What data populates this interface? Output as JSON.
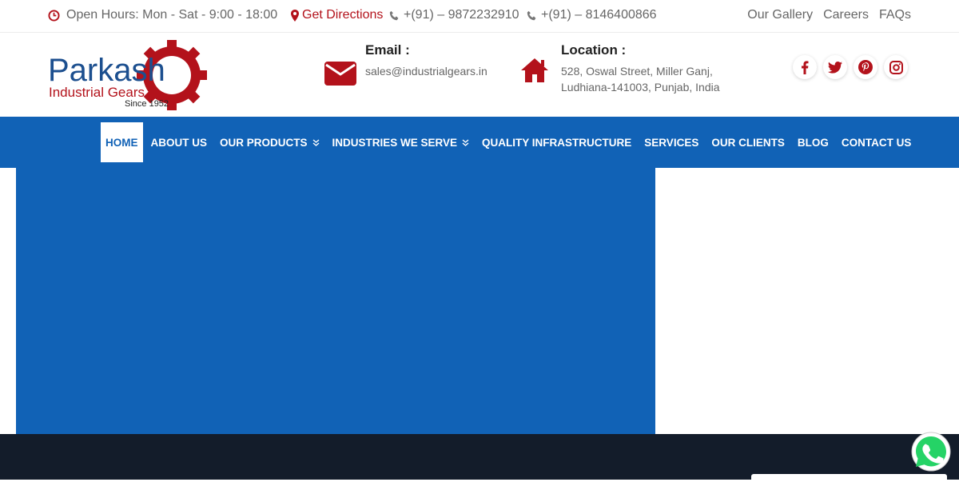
{
  "topbar": {
    "hours": "Open Hours: Mon - Sat - 9:00 - 18:00",
    "directions": "Get Directions",
    "phone1": "+(91) – 9872232910",
    "phone2": "+(91) – 8146400866",
    "links": [
      "Our Gallery",
      "Careers",
      "FAQs"
    ]
  },
  "header": {
    "logo": {
      "name": "Parkash",
      "sub": "Industrial Gears",
      "since": "Since 1952"
    },
    "email": {
      "title": "Email :",
      "value": "sales@industrialgears.in"
    },
    "location": {
      "title": "Location :",
      "line1": "528, Oswal Street, Miller Ganj,",
      "line2": "Ludhiana-141003, Punjab, India"
    },
    "social": [
      "facebook-icon",
      "twitter-icon",
      "pinterest-icon",
      "instagram-icon"
    ]
  },
  "nav": {
    "items": [
      "HOME",
      "ABOUT US",
      "OUR PRODUCTS",
      "INDUSTRIES WE SERVE",
      "QUALITY INFRASTRUCTURE",
      "SERVICES",
      "OUR CLIENTS",
      "BLOG",
      "CONTACT US"
    ],
    "active": "HOME"
  },
  "colors": {
    "brand_blue": "#1162b6",
    "brand_red": "#b3121b",
    "footer": "#131c2a",
    "whatsapp": "#25d366"
  }
}
